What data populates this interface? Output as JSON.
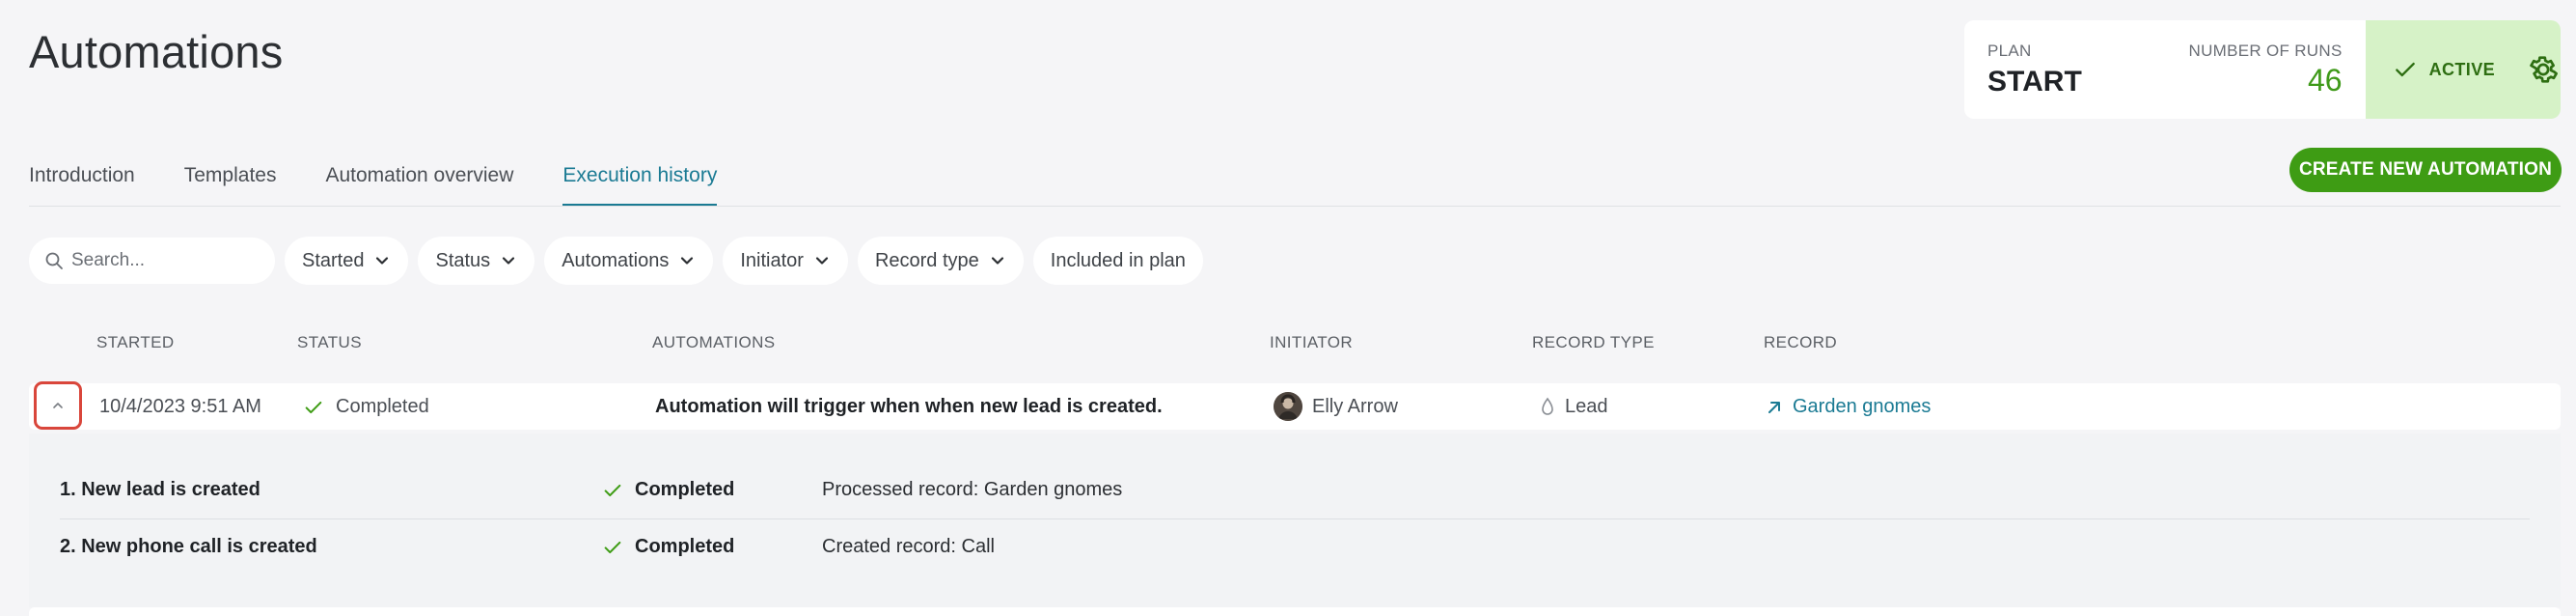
{
  "page": {
    "title": "Automations"
  },
  "plan": {
    "plan_label": "PLAN",
    "plan_value": "START",
    "runs_label": "NUMBER OF RUNS",
    "runs_value": "46",
    "active_label": "ACTIVE"
  },
  "tabs": [
    {
      "label": "Introduction"
    },
    {
      "label": "Templates"
    },
    {
      "label": "Automation overview"
    },
    {
      "label": "Execution history",
      "active": true
    }
  ],
  "create_button": {
    "label": "CREATE NEW AUTOMATION"
  },
  "search": {
    "placeholder": "Search..."
  },
  "filters": [
    {
      "label": "Started"
    },
    {
      "label": "Status"
    },
    {
      "label": "Automations"
    },
    {
      "label": "Initiator"
    },
    {
      "label": "Record type"
    },
    {
      "label": "Included in plan"
    }
  ],
  "table": {
    "columns": [
      "STARTED",
      "STATUS",
      "AUTOMATIONS",
      "INITIATOR",
      "RECORD TYPE",
      "RECORD"
    ],
    "rows": [
      {
        "started": "10/4/2023 9:51 AM",
        "status": "Completed",
        "automation": "Automation will trigger when when new lead is created.",
        "initiator": "Elly Arrow",
        "record_type": "Lead",
        "record": "Garden gnomes",
        "steps": [
          {
            "name": "1. New lead is created",
            "status": "Completed",
            "detail": "Processed record: Garden gnomes"
          },
          {
            "name": "2. New phone call is created",
            "status": "Completed",
            "detail": "Created record: Call"
          }
        ]
      }
    ]
  },
  "colors": {
    "accent": "#1a7a93",
    "success": "#3e9c14",
    "active_bg": "#d6f2c7",
    "highlight": "#d9463b"
  }
}
